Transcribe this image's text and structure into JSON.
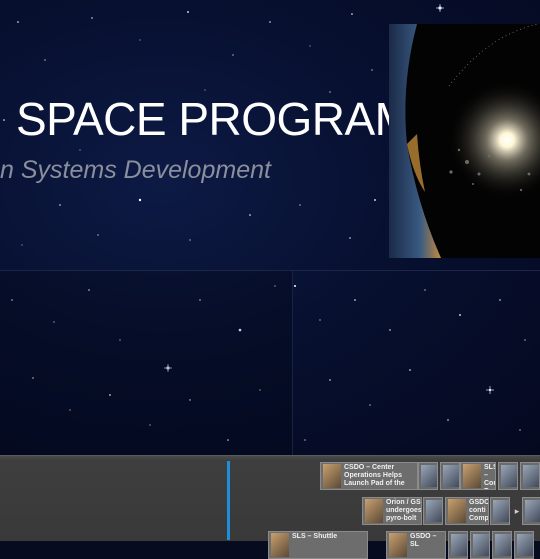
{
  "hero": {
    "title": "SPACE PROGRAM",
    "subtitle": "n Systems Development"
  },
  "timeline": {
    "row1": {
      "clip1": "CSDO – Center Operations Helps Launch Pad of the",
      "clip2": "SLS – Conti Prepa"
    },
    "row2": {
      "clip1": "Orion / GS undergoes pyro-bolt",
      "clip2": "GSDO conti Comp"
    },
    "row3": {
      "clip1": "SLS – Shuttle",
      "clip2": "GSDO – SL"
    }
  },
  "colors": {
    "space_bg": "#050920",
    "playhead": "#1c8fd6",
    "timeline_bg": "#3e3e3e"
  }
}
